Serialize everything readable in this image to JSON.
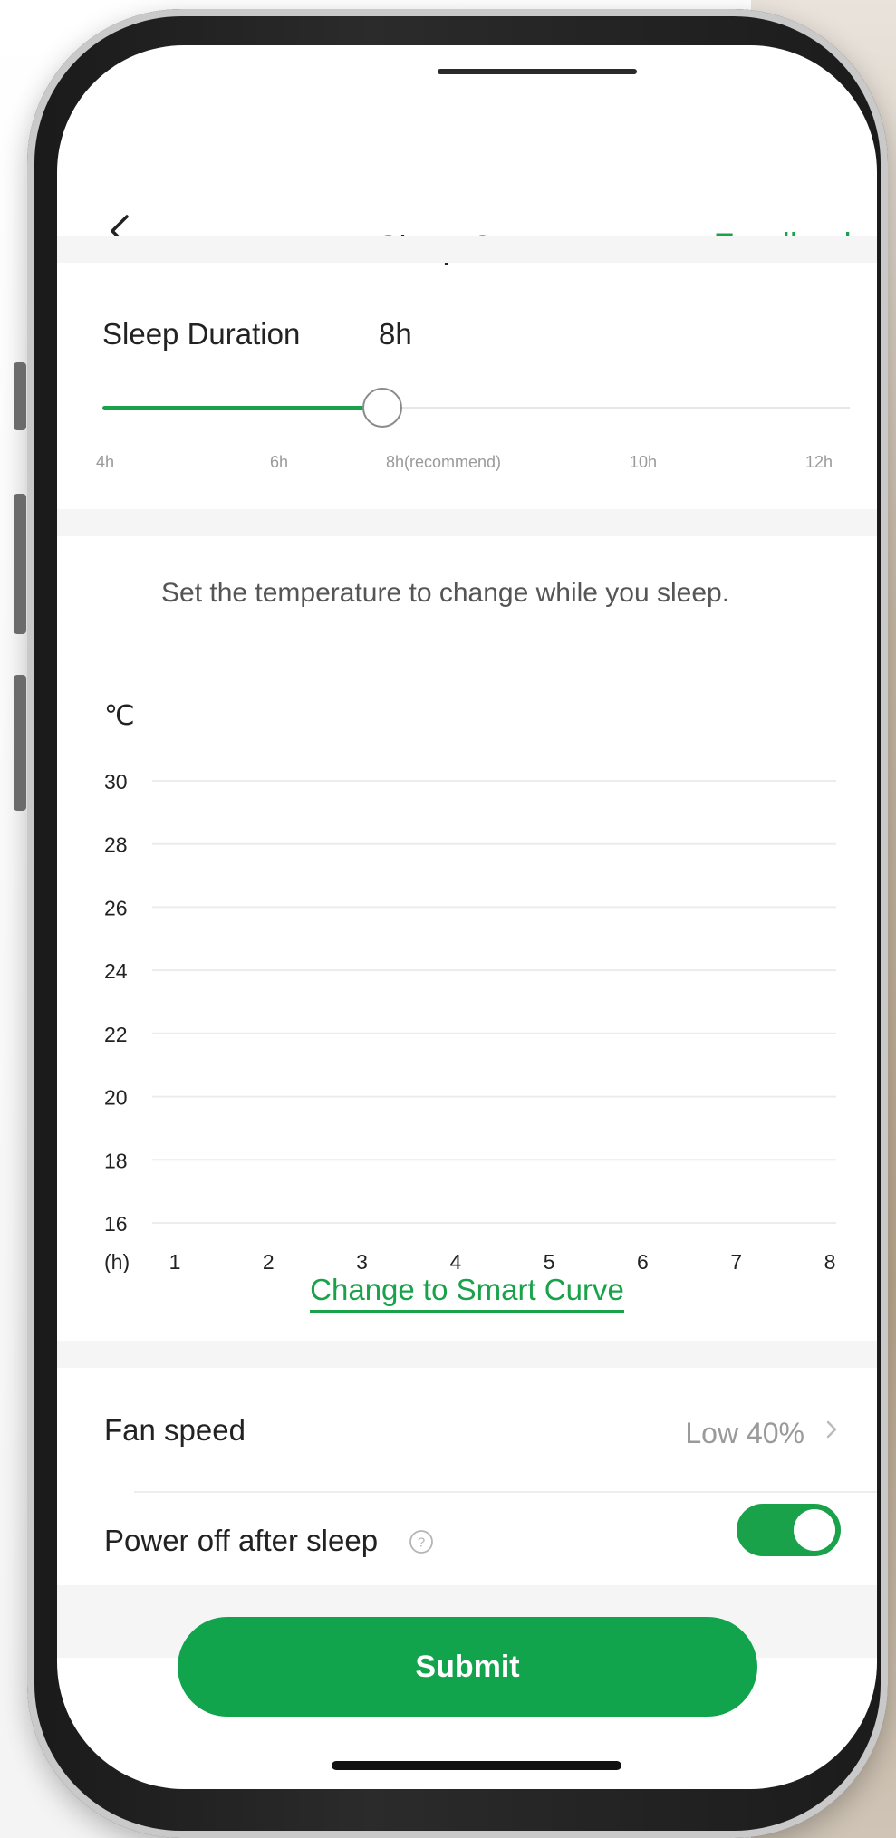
{
  "header": {
    "title": "Sleep Curve",
    "feedback_label": "Feedback"
  },
  "duration": {
    "label": "Sleep Duration",
    "value": "8h",
    "selected_hours": 8,
    "min_hours": 4,
    "max_hours": 12,
    "ticks": [
      "4h",
      "6h",
      "8h(recommend)",
      "10h",
      "12h"
    ]
  },
  "chart": {
    "note": "Set the temperature to change while you sleep.",
    "y_unit": "℃",
    "x_unit": "(h)",
    "link_label": "Change to Smart Curve"
  },
  "chart_data": {
    "type": "line",
    "x": [
      1,
      2,
      3,
      4,
      5,
      6,
      7,
      8
    ],
    "y_ticks": [
      30,
      28,
      26,
      24,
      22,
      20,
      18,
      16
    ],
    "ylim": [
      16,
      30
    ],
    "series": [],
    "grid": true
  },
  "settings": {
    "fan_speed_label": "Fan speed",
    "fan_speed_value": "Low 40%",
    "power_off_label": "Power off after sleep",
    "power_off_enabled": true
  },
  "footer": {
    "submit_label": "Submit"
  },
  "colors": {
    "accent": "#1aa24b",
    "submit": "#12a44c",
    "muted": "#9a9a9a"
  }
}
